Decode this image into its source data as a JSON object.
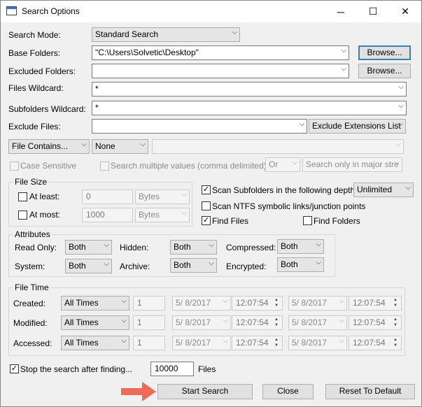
{
  "window": {
    "title": "Search Options",
    "minimize": "─",
    "maximize": "☐",
    "close": "✕"
  },
  "search_mode": {
    "label": "Search Mode:",
    "value": "Standard Search"
  },
  "base_folders": {
    "label": "Base Folders:",
    "value": "\"C:\\Users\\Solvetic\\Desktop\"",
    "browse": "Browse..."
  },
  "excluded_folders": {
    "label": "Excluded Folders:",
    "value": "",
    "browse": "Browse..."
  },
  "files_wildcard": {
    "label": "Files Wildcard:",
    "value": "*"
  },
  "subfolders_wildcard": {
    "label": "Subfolders Wildcard:",
    "value": "*"
  },
  "exclude_files": {
    "label": "Exclude Files:",
    "value": "",
    "mode": "Exclude Extensions List"
  },
  "contains": {
    "type": "File Contains...",
    "format": "None",
    "value": "",
    "case_sensitive": "Case Sensitive",
    "multiple_values": "Search multiple values (comma delimited)",
    "logic": "Or",
    "scope": "Search only in major stre"
  },
  "file_size": {
    "title": "File Size",
    "at_least": {
      "label": "At least:",
      "value": "0",
      "unit": "Bytes"
    },
    "at_most": {
      "label": "At most:",
      "value": "1000",
      "unit": "Bytes"
    }
  },
  "options": {
    "scan_subfolders": "Scan Subfolders in the following depth:",
    "depth": "Unlimited",
    "scan_ntfs": "Scan NTFS symbolic links/junction points",
    "find_files": "Find Files",
    "find_folders": "Find Folders"
  },
  "attributes": {
    "title": "Attributes",
    "read_only": {
      "label": "Read Only:",
      "value": "Both"
    },
    "hidden": {
      "label": "Hidden:",
      "value": "Both"
    },
    "compressed": {
      "label": "Compressed:",
      "value": "Both"
    },
    "system": {
      "label": "System:",
      "value": "Both"
    },
    "archive": {
      "label": "Archive:",
      "value": "Both"
    },
    "encrypted": {
      "label": "Encrypted:",
      "value": "Both"
    }
  },
  "file_time": {
    "title": "File Time",
    "rows": [
      {
        "label": "Created:",
        "mode": "All Times",
        "count": "1",
        "date1": "5/  8/2017",
        "time1": "12:07:54",
        "date2": "5/  8/2017",
        "time2": "12:07:54"
      },
      {
        "label": "Modified:",
        "mode": "All Times",
        "count": "1",
        "date1": "5/  8/2017",
        "time1": "12:07:54",
        "date2": "5/  8/2017",
        "time2": "12:07:54"
      },
      {
        "label": "Accessed:",
        "mode": "All Times",
        "count": "1",
        "date1": "5/  8/2017",
        "time1": "12:07:54",
        "date2": "5/  8/2017",
        "time2": "12:07:54"
      }
    ]
  },
  "stop_after": {
    "label": "Stop the search after finding...",
    "value": "10000",
    "unit": "Files"
  },
  "buttons": {
    "start": "Start Search",
    "close": "Close",
    "reset": "Reset To Default"
  },
  "icons": {
    "dropdown": "chevron-down-icon",
    "check": "check-icon",
    "spinner": "spinner-icon"
  },
  "colors": {
    "accent": "#3c7fb1",
    "pointer": "#ee6b5a"
  }
}
